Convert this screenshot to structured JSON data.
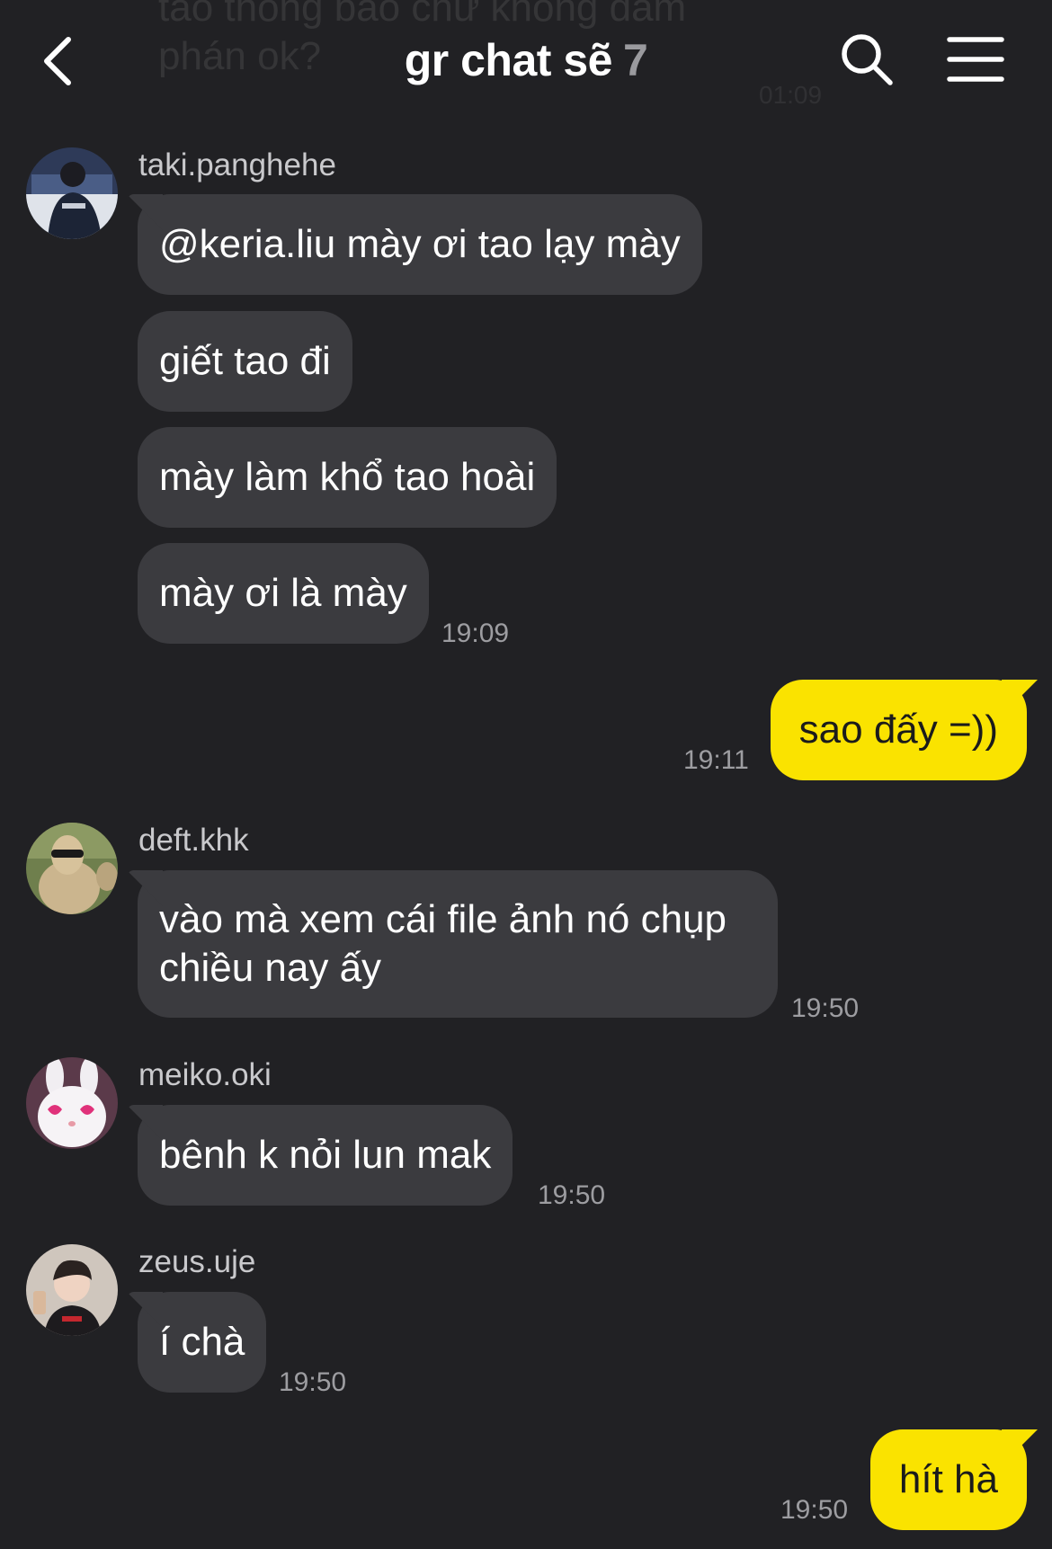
{
  "header": {
    "ghost_text": "tao thông báo chứ không dám phán ok?",
    "ghost_time": "01:09",
    "title": "gr chat sẽ",
    "member_count": "7",
    "back_icon": "chevron-left-icon",
    "search_icon": "search-icon",
    "menu_icon": "hamburger-menu-icon"
  },
  "colors": {
    "background": "#212124",
    "received_bubble": "#3b3b3f",
    "sent_bubble": "#fae300",
    "timestamp": "#9d9da1"
  },
  "messages": {
    "g1": {
      "sender": "taki.panghehe",
      "m1": "@keria.liu mày ơi tao lạy mày",
      "m2": "giết tao đi",
      "m3": "mày làm khổ tao hoài",
      "m4": "mày ơi là mày",
      "time": "19:09"
    },
    "out1": {
      "text": "sao đấy =))",
      "time": "19:11"
    },
    "g2": {
      "sender": "deft.khk",
      "m1": "vào mà xem cái file ảnh nó chụp chiều nay ấy",
      "time": "19:50"
    },
    "g3": {
      "sender": "meiko.oki",
      "m1": "bênh k nỏi lun mak",
      "time": "19:50"
    },
    "g4": {
      "sender": "zeus.uje",
      "m1": "í chà",
      "time": "19:50"
    },
    "out2": {
      "text": "hít hà",
      "time": "19:50"
    }
  }
}
